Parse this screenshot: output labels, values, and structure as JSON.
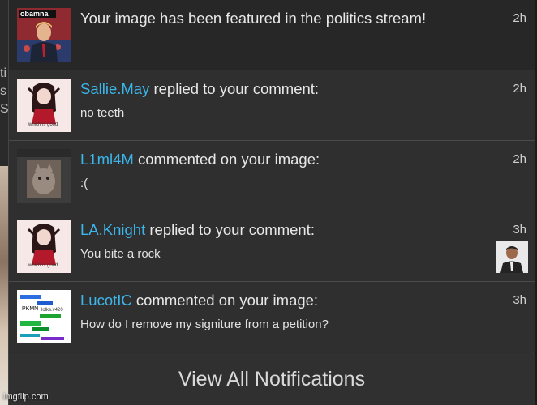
{
  "background": {
    "left_text": "ti\ns\nSt"
  },
  "notifications": [
    {
      "headline": "Your image has been featured in the politics stream!",
      "user": "",
      "action": "",
      "body": "",
      "time": "2h",
      "thumb_caption": "obamna"
    },
    {
      "user": "Sallie.May",
      "action": " replied to your comment:",
      "body": "no teeth",
      "time": "2h",
      "thumb_caption": "which is good"
    },
    {
      "user": "L1ml4M",
      "action": " commented on your image:",
      "body": ":(",
      "time": "2h"
    },
    {
      "user": "LA.Knight",
      "action": " replied to your comment:",
      "body": "You bite a rock",
      "time": "3h",
      "thumb_caption": "which is good"
    },
    {
      "user": "LucotIC",
      "action": " commented on your image:",
      "body": "How do I remove my signiture from a petition?",
      "time": "3h",
      "thumb_lines": [
        "PKMN",
        "lolks.v420",
        "LucoIC"
      ]
    }
  ],
  "footer": {
    "view_all_label": "View All Notifications"
  },
  "watermark": "imgflip.com",
  "colors": {
    "username": "#3bb6ea",
    "panel": "#2e2e2e",
    "divider": "#4a4a4a"
  }
}
